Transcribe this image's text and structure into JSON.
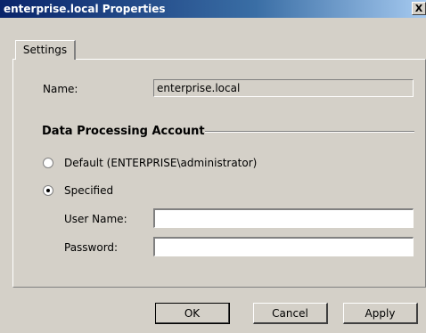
{
  "window": {
    "title": "enterprise.local Properties",
    "close_label": "X"
  },
  "tabs": [
    {
      "label": "Settings",
      "selected": true
    }
  ],
  "settings": {
    "name_label": "Name:",
    "name_value": "enterprise.local",
    "group_title": "Data Processing Account",
    "options": [
      {
        "label": "Default (ENTERPRISE\\administrator)",
        "selected": false
      },
      {
        "label": "Specified",
        "selected": true
      }
    ],
    "username_label": "User Name:",
    "username_value": "",
    "password_label": "Password:",
    "password_value": ""
  },
  "buttons": {
    "ok": "OK",
    "cancel": "Cancel",
    "apply": "Apply"
  }
}
